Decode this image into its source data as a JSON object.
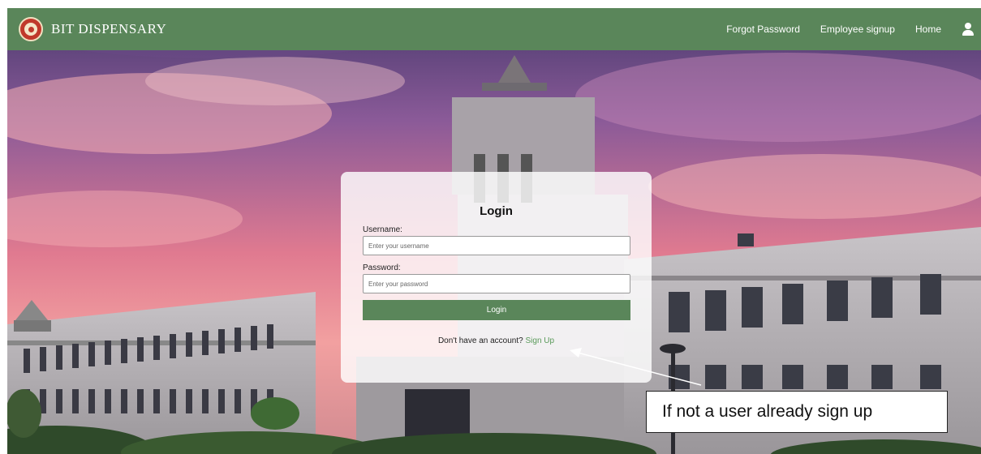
{
  "navbar": {
    "brand": "BIT DISPENSARY",
    "links": [
      "Forgot Password",
      "Employee signup",
      "Home"
    ],
    "icons": {
      "logo": "college-seal-icon",
      "user": "user-icon"
    },
    "color": "#5a865a"
  },
  "login": {
    "title": "Login",
    "username_label": "Username:",
    "username_placeholder": "Enter your username",
    "password_label": "Password:",
    "password_placeholder": "Enter your password",
    "button_label": "Login",
    "signup_prompt": "Don't have an account?",
    "signup_link": "Sign Up"
  },
  "annotation": {
    "text": "If not a user already sign up"
  }
}
